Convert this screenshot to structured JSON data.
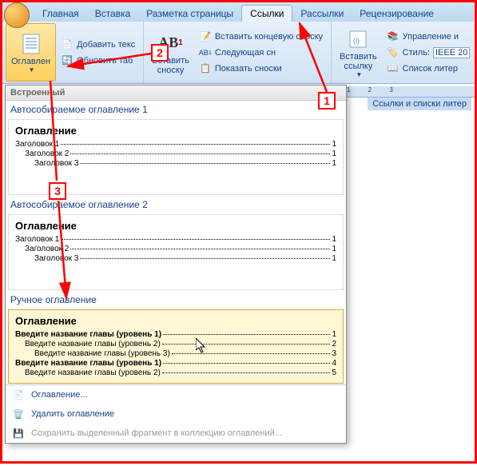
{
  "office_button": "Office",
  "tabs": {
    "home": "Главная",
    "insert": "Вставка",
    "layout": "Разметка страницы",
    "refs": "Ссылки",
    "mail": "Рассылки",
    "review": "Рецензирование"
  },
  "ribbon": {
    "toc_btn": "Оглавлен",
    "add_text": "Добавить текс",
    "update_table": "Обновить таб",
    "insert_footnote": "Вставить\nсноску",
    "ab_label": "AB",
    "next_footnote": "Следующая сн",
    "insert_endnote": "Вставить концевую сноску",
    "show_notes": "Показать сноски",
    "insert_link": "Вставить\nссылку",
    "manage": "Управление и",
    "style_lbl": "Стиль:",
    "style_val": "IEEE 20",
    "biblio": "Список литер",
    "link_label": "Ссылки и списки литер"
  },
  "gallery": {
    "builtin": "Встроенный",
    "auto1": "Автособираемое оглавление 1",
    "auto2": "Автособираемое оглавление 2",
    "manual": "Ручное оглавление",
    "toc_title": "Оглавление",
    "h1": "Заголовок 1",
    "h2": "Заголовок 2",
    "h3": "Заголовок 3",
    "m1": "Введите название главы (уровень 1)",
    "m2": "Введите название главы (уровень 2)",
    "m3": "Введите название главы (уровень 3)",
    "p1": "1",
    "p2": "2",
    "p3": "3",
    "p4": "4",
    "p5": "5",
    "menu_toc": "Оглавление...",
    "menu_remove": "Удалить оглавление",
    "menu_save": "Сохранить выделенный фрагмент в коллекцию оглавлений..."
  },
  "annotations": {
    "n1": "1",
    "n2": "2",
    "n3": "3"
  },
  "ruler_marks": "1 2 3"
}
